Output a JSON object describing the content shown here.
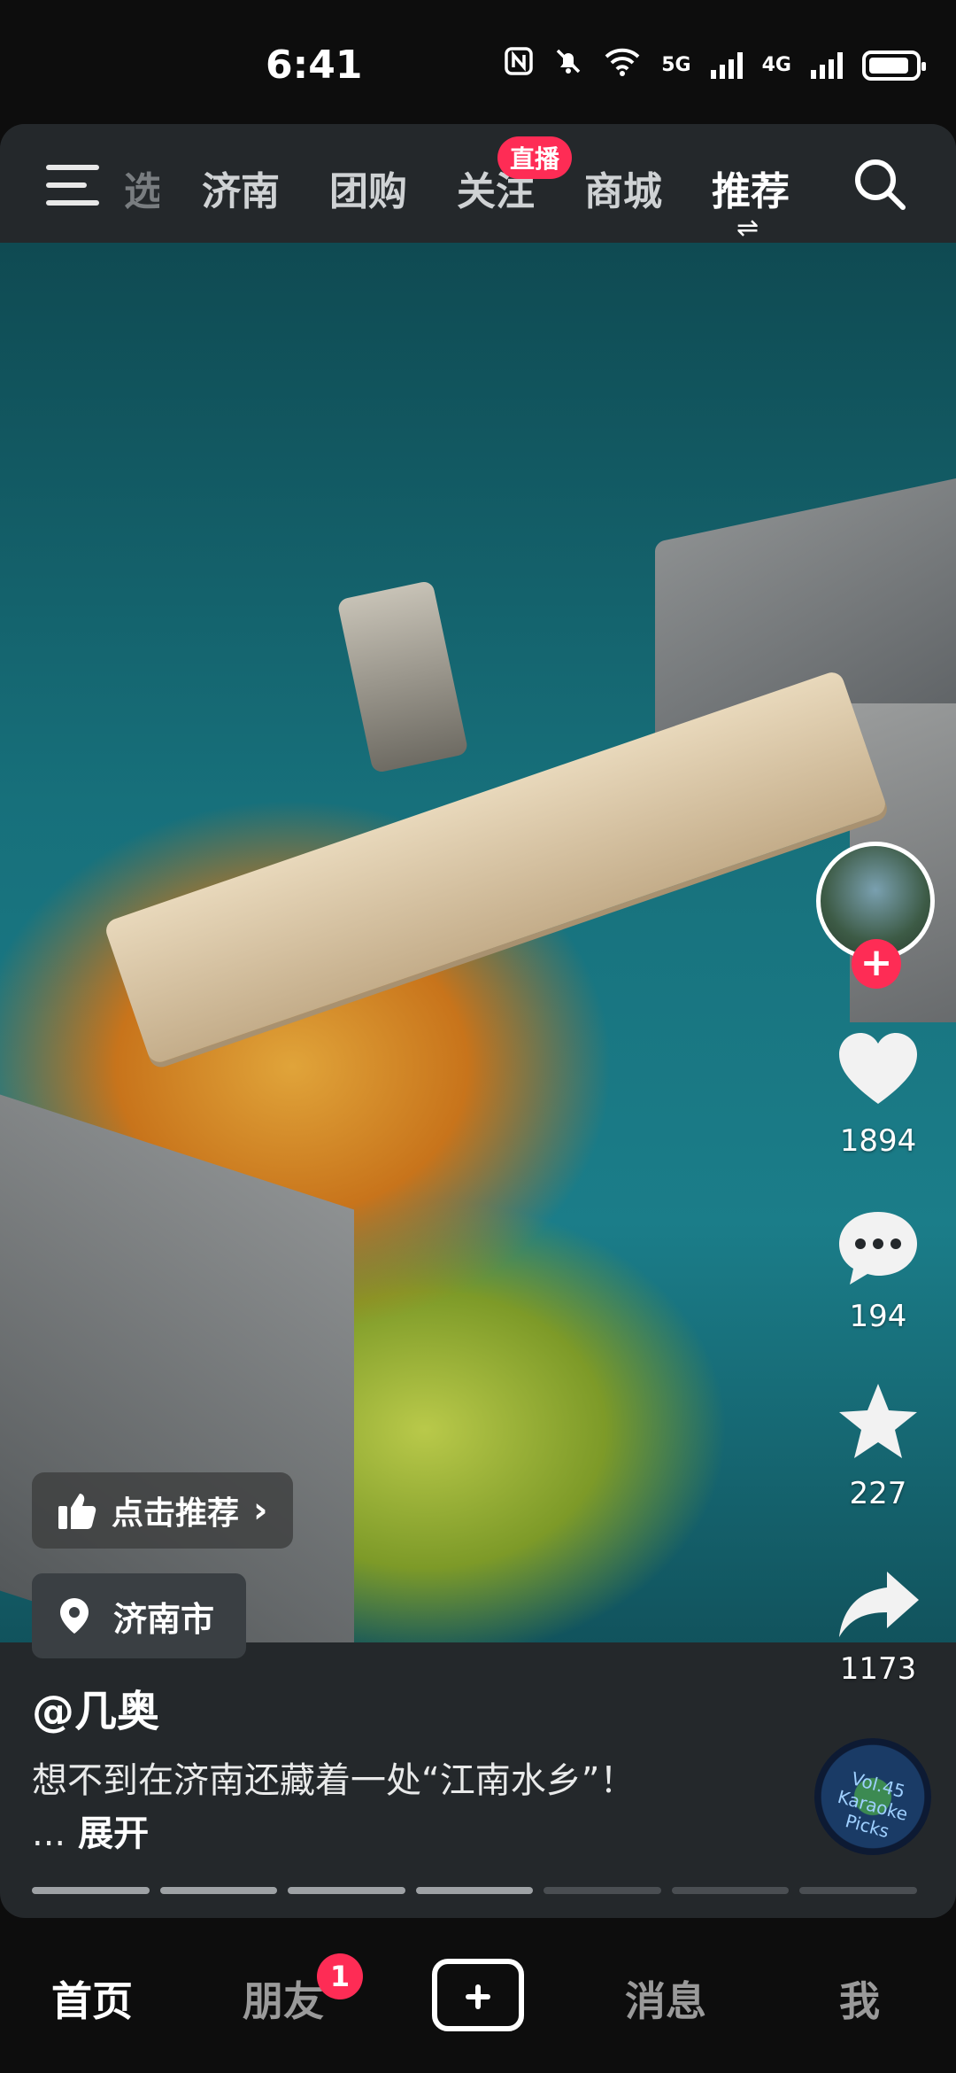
{
  "status_bar": {
    "time": "6:41",
    "network_1": "5G",
    "network_2": "4G"
  },
  "top_nav": {
    "partial_tab": "选",
    "tabs": [
      "济南",
      "团购",
      "关注",
      "商城",
      "推荐"
    ],
    "active_tab": "推荐",
    "live_badge": "直播"
  },
  "side_actions": {
    "likes": "1894",
    "comments": "194",
    "favorites": "227",
    "shares": "1173"
  },
  "video": {
    "recommend_chip": "点击推荐",
    "location": "济南市",
    "author": "@几奥",
    "caption": "想不到在济南还藏着一处“江南水乡”！ ...",
    "expand_label": "展开",
    "music_disc_text": "Vol.45 Karaoke Picks"
  },
  "bottom_nav": {
    "items": [
      "首页",
      "朋友",
      "消息",
      "我"
    ],
    "friends_badge": "1"
  },
  "progress": {
    "segments": 7,
    "active": 4
  },
  "colors": {
    "accent": "#fe2c55",
    "background": "#24282b"
  }
}
